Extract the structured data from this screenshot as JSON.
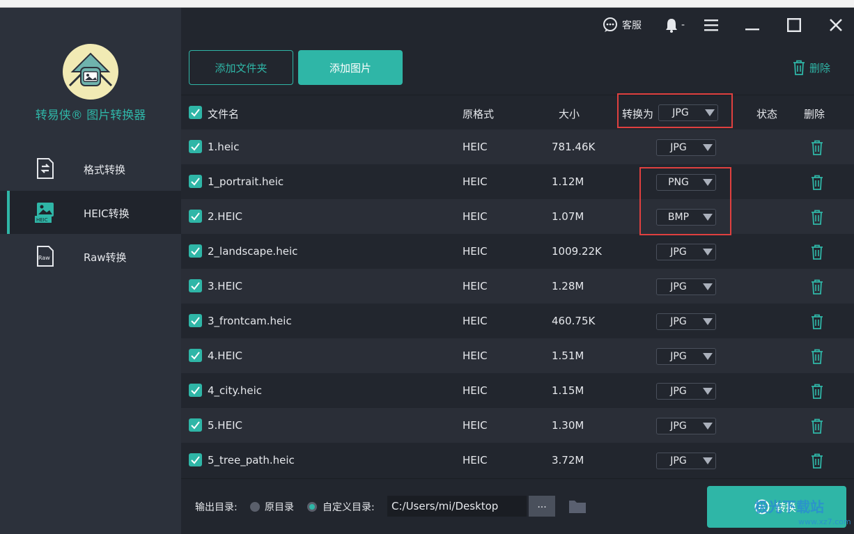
{
  "app": {
    "brand": "转易侠® 图片转换器",
    "accent_color": "#2fb6a7",
    "highlight_color": "#e0403f"
  },
  "sidebar": {
    "items": [
      {
        "label": "格式转换",
        "icon": "format-convert-icon"
      },
      {
        "label": "HEIC转换",
        "icon": "heic-image-icon"
      },
      {
        "label": "Raw转换",
        "icon": "raw-file-icon"
      }
    ]
  },
  "titlebar": {
    "support_label": "客服",
    "notify_label": "-"
  },
  "toolbar": {
    "add_folder": "添加文件夹",
    "add_image": "添加图片",
    "delete": "删除"
  },
  "table": {
    "headers": {
      "name": "文件名",
      "orig_format": "原格式",
      "size": "大小",
      "convert_to": "转换为",
      "status": "状态",
      "delete": "删除"
    },
    "global_format": "JPG",
    "rows": [
      {
        "name": "1.heic",
        "format": "HEIC",
        "size": "781.46K",
        "target": "JPG"
      },
      {
        "name": "1_portrait.heic",
        "format": "HEIC",
        "size": "1.12M",
        "target": "PNG"
      },
      {
        "name": "2.HEIC",
        "format": "HEIC",
        "size": "1.07M",
        "target": "BMP"
      },
      {
        "name": "2_landscape.heic",
        "format": "HEIC",
        "size": "1009.22K",
        "target": "JPG"
      },
      {
        "name": "3.HEIC",
        "format": "HEIC",
        "size": "1.28M",
        "target": "JPG"
      },
      {
        "name": "3_frontcam.heic",
        "format": "HEIC",
        "size": "460.75K",
        "target": "JPG"
      },
      {
        "name": "4.HEIC",
        "format": "HEIC",
        "size": "1.51M",
        "target": "JPG"
      },
      {
        "name": "4_city.heic",
        "format": "HEIC",
        "size": "1.15M",
        "target": "JPG"
      },
      {
        "name": "5.HEIC",
        "format": "HEIC",
        "size": "1.30M",
        "target": "JPG"
      },
      {
        "name": "5_tree_path.heic",
        "format": "HEIC",
        "size": "3.72M",
        "target": "JPG"
      }
    ]
  },
  "footer": {
    "output_label": "输出目录:",
    "option_original": "原目录",
    "option_custom": "自定义目录:",
    "path": "C:/Users/mi/Desktop",
    "browse": "...",
    "convert": "转换"
  },
  "watermark": {
    "text": "极光下载站",
    "url": "www.xz7.com"
  }
}
